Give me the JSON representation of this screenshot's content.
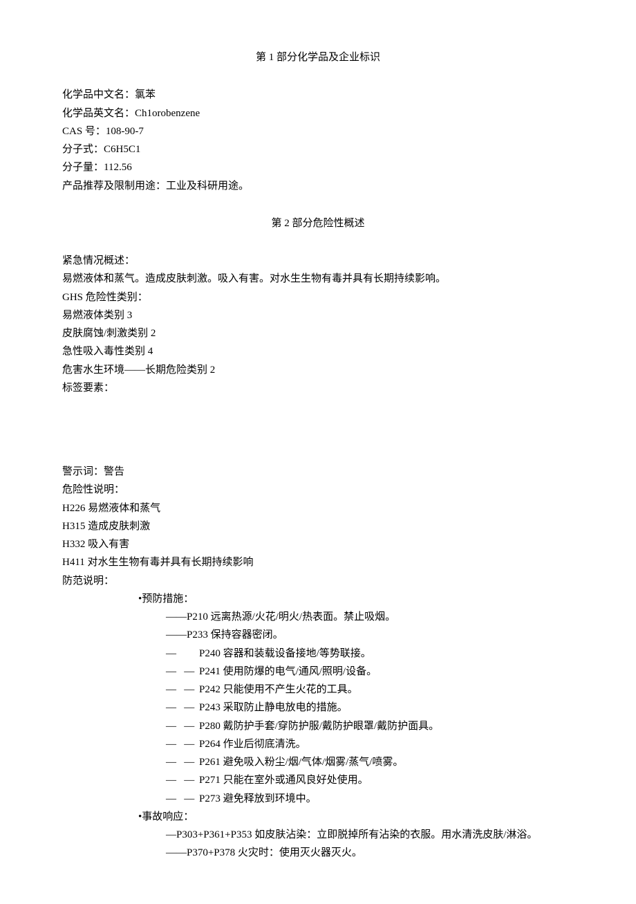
{
  "section1": {
    "title": "第 1 部分化学品及企业标识",
    "lines": [
      "化学品中文名：氯苯",
      "化学品英文名：Ch1orobenzene",
      "CAS 号：108-90-7",
      "分子式：C6H5C1",
      "分子量：112.56",
      "产品推荐及限制用途：工业及科研用途。"
    ]
  },
  "section2": {
    "title": "第 2 部分危险性概述",
    "emergency_label": "紧急情况概述：",
    "emergency_text": "易燃液体和蒸气。造成皮肤刺激。吸入有害。对水生生物有毒并具有长期持续影响。",
    "ghs_label": "GHS 危险性类别：",
    "ghs_categories": [
      "易燃液体类别 3",
      "皮肤腐蚀/刺激类别 2",
      "急性吸入毒性类别 4",
      "危害水生环境——长期危险类别 2"
    ],
    "label_elements_label": "标签要素：",
    "signal_word_line": "警示词：警告",
    "hazard_statements_label": "危险性说明：",
    "hazard_statements": [
      "H226 易燃液体和蒸气",
      "H315 造成皮肤刺激",
      "H332 吸入有害",
      "H411 对水生生物有毒并具有长期持续影响"
    ],
    "precaution_label": "防范说明：",
    "prevention_label": "•预防措施：",
    "prevention_items": [
      {
        "prefix": "——",
        "text": "P210 远离热源/火花/明火/热表面。禁止吸烟。"
      },
      {
        "prefix": "——",
        "text": "P233 保持容器密闭。"
      },
      {
        "prefix": "—",
        "text": "P240 容器和装载设备接地/等势联接。"
      },
      {
        "prefix": "—   —",
        "text": "P241 使用防爆的电气/通风/照明/设备。"
      },
      {
        "prefix": "—   —",
        "text": "P242 只能使用不产生火花的工具。"
      },
      {
        "prefix": "—   —",
        "text": "P243 采取防止静电放电的措施。"
      },
      {
        "prefix": "—   —",
        "text": "P280 戴防护手套/穿防护服/戴防护眼罩/戴防护面具。"
      },
      {
        "prefix": "—   —",
        "text": "P264 作业后彻底清洗。"
      },
      {
        "prefix": "—   —",
        "text": "P261 避免吸入粉尘/烟/气体/烟雾/蒸气/喷雾。"
      },
      {
        "prefix": "—   —",
        "text": "P271 只能在室外或通风良好处使用。"
      },
      {
        "prefix": "—   —",
        "text": "P273 避免释放到环境中。"
      }
    ],
    "response_label": "•事故响应：",
    "response_items": [
      {
        "prefix": "—",
        "text": "P303+P361+P353 如皮肤沾染：立即脱掉所有沾染的衣服。用水清洗皮肤/淋浴。"
      },
      {
        "prefix": "——",
        "text": "P370+P378 火灾时：使用灭火器灭火。"
      }
    ]
  }
}
